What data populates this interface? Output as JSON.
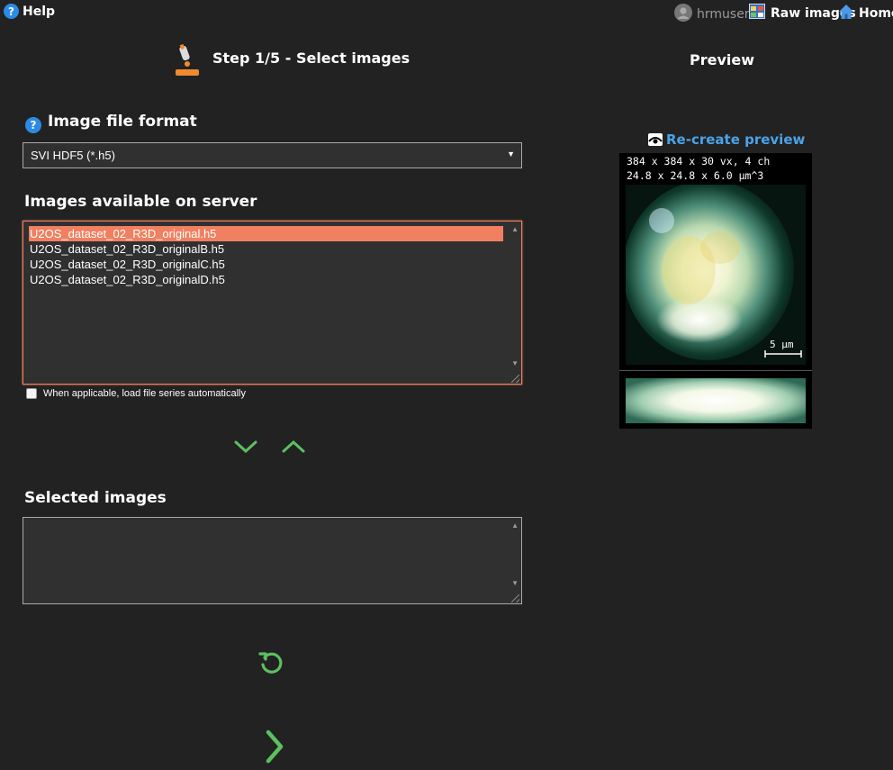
{
  "topbar": {
    "help_label": "Help",
    "user_label": "hrmuser",
    "raw_images_label": "Raw images",
    "home_label": "Home"
  },
  "step": {
    "title": "Step 1/5 - Select images"
  },
  "preview": {
    "heading": "Preview",
    "recreate_label": "Re-create preview",
    "info_line1": "384 x 384 x 30 vx, 4 ch",
    "info_line2": "24.8 x 24.8 x 6.0 µm^3",
    "scale_label": "5 µm"
  },
  "format": {
    "heading": "Image file format",
    "selected": "SVI HDF5 (*.h5)"
  },
  "available": {
    "heading": "Images available on server",
    "items": [
      "U2OS_dataset_02_R3D_original.h5",
      "U2OS_dataset_02_R3D_originalB.h5",
      "U2OS_dataset_02_R3D_originalC.h5",
      "U2OS_dataset_02_R3D_originalD.h5"
    ],
    "selected_index": 0
  },
  "autoload": {
    "label": "When applicable, load file series automatically"
  },
  "selected_images": {
    "heading": "Selected images"
  },
  "colors": {
    "background": "#222222",
    "accent_green": "#5cc060",
    "selection_orange": "#f08060",
    "link_blue": "#4aa3e8",
    "help_blue": "#2b8be6"
  }
}
